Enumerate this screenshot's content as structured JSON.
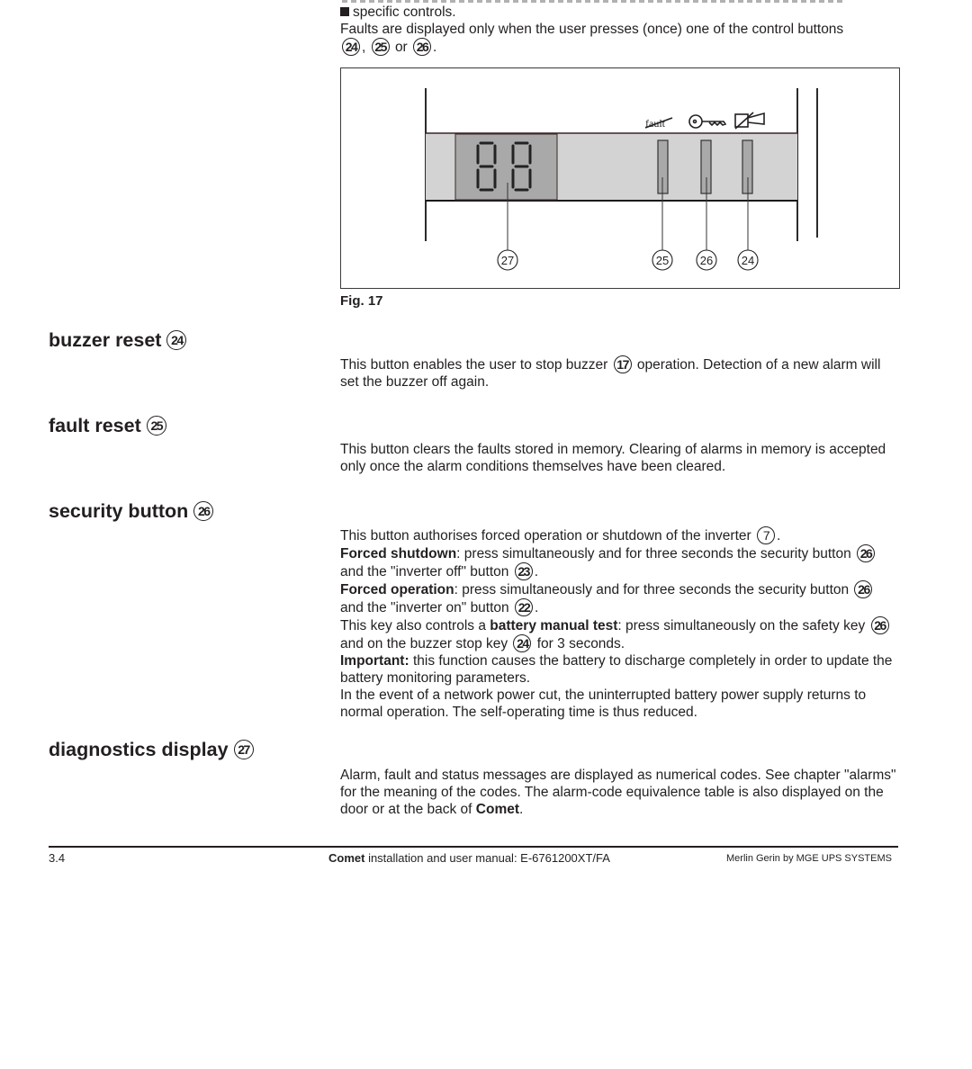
{
  "intro": {
    "bullet_text": "specific controls.",
    "faults_line_prefix": "Faults are displayed only when the user presses (once) one of the control buttons",
    "faults_refs": [
      "24",
      "25",
      "26"
    ],
    "faults_sep_1": ",",
    "faults_sep_2": "or",
    "faults_end": "."
  },
  "figure": {
    "caption": "Fig. 17",
    "icon_labels": {
      "fault": "fault"
    },
    "display_digits": "88",
    "callouts": [
      "27",
      "25",
      "26",
      "24"
    ]
  },
  "sections": [
    {
      "heading": "buzzer reset",
      "ref": "24",
      "paragraphs": {
        "p1_a": "This button enables the user to stop buzzer",
        "p1_ref": "17",
        "p1_b": "operation. Detection of a new alarm will set the buzzer off again."
      }
    },
    {
      "heading": "fault reset",
      "ref": "25",
      "paragraphs": {
        "p1": "This button clears the faults stored in memory. Clearing of alarms in memory is accepted only once the alarm conditions themselves have been cleared."
      }
    },
    {
      "heading": "security button",
      "ref": "26",
      "paragraphs": {
        "l1_a": "This button authorises forced operation or shutdown of the inverter",
        "l1_ref": "7",
        "l1_end": ".",
        "l2_bold": "Forced shutdown",
        "l2_a": ": press simultaneously and for three seconds the security button",
        "l2_ref1": "26",
        "l2_b": "and the \"inverter off\" button",
        "l2_ref2": "23",
        "l2_end": ".",
        "l3_bold": "Forced operation",
        "l3_a": ": press simultaneously and for three seconds the security button",
        "l3_ref1": "26",
        "l3_b": "and the \"inverter on\" button",
        "l3_ref2": "22",
        "l3_end": ".",
        "l4_a": "This key also controls a ",
        "l4_bold": "battery manual test",
        "l4_b": ": press simultaneously on the safety key",
        "l4_ref1": "26",
        "l4_c": "and on the buzzer stop key",
        "l4_ref2": "24",
        "l4_d": "for 3 seconds.",
        "l5_bold": "Important:",
        "l5_a": " this function causes the battery to discharge completely in order to update the battery monitoring parameters.",
        "l6": "In the event of a network power cut, the uninterrupted battery power supply returns to normal operation. The self-operating time is thus reduced."
      }
    },
    {
      "heading": "diagnostics display",
      "ref": "27",
      "paragraphs": {
        "p1_a": "Alarm, fault and status messages are displayed as numerical codes. See chapter \"alarms\" for the meaning of the codes. The alarm-code equivalence table is also displayed on the door or at the back of ",
        "p1_bold": "Comet",
        "p1_end": "."
      }
    }
  ],
  "footer": {
    "page_number": "3.4",
    "center_bold": "Comet",
    "center_text": " installation and user manual: E-6761200XT/FA",
    "right_text": "Merlin Gerin by MGE UPS SYSTEMS"
  }
}
